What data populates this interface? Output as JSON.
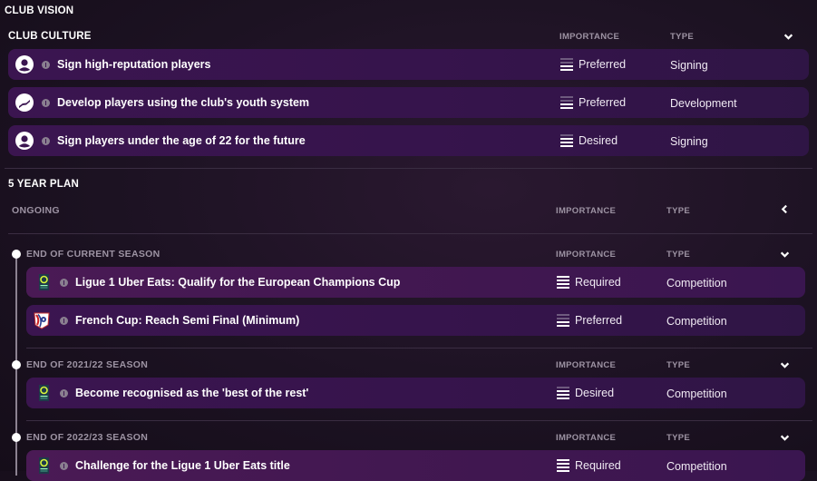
{
  "title": "CLUB VISION",
  "columns": {
    "importance": "IMPORTANCE",
    "type": "TYPE"
  },
  "club_culture": {
    "title": "CLUB CULTURE",
    "items": [
      {
        "icon": "person-icon",
        "label": "Sign high-reputation players",
        "importance": "Preferred",
        "importance_level": 2,
        "type": "Signing"
      },
      {
        "icon": "youth-development-icon",
        "label": "Develop players using the club's youth system",
        "importance": "Preferred",
        "importance_level": 2,
        "type": "Development"
      },
      {
        "icon": "person-icon",
        "label": "Sign players under the age of 22 for the future",
        "importance": "Desired",
        "importance_level": 3,
        "type": "Signing"
      }
    ]
  },
  "five_year_plan": {
    "title": "5 YEAR PLAN",
    "ongoing": {
      "title": "ONGOING"
    },
    "groups": [
      {
        "title": "END OF CURRENT SEASON",
        "items": [
          {
            "icon": "ligue1-logo-icon",
            "label": "Ligue 1 Uber Eats: Qualify for the European Champions Cup",
            "importance": "Required",
            "importance_level": 4,
            "type": "Competition"
          },
          {
            "icon": "french-cup-logo-icon",
            "label": "French Cup: Reach Semi Final (Minimum)",
            "importance": "Preferred",
            "importance_level": 2,
            "type": "Competition"
          }
        ]
      },
      {
        "title": "END OF 2021/22 SEASON",
        "items": [
          {
            "icon": "ligue1-logo-icon",
            "label": "Become recognised as the 'best of the rest'",
            "importance": "Desired",
            "importance_level": 3,
            "type": "Competition"
          }
        ]
      },
      {
        "title": "END OF 2022/23 SEASON",
        "items": [
          {
            "icon": "ligue1-logo-icon",
            "label": "Challenge for the Ligue 1 Uber Eats title",
            "importance": "Required",
            "importance_level": 4,
            "type": "Competition"
          }
        ]
      }
    ]
  }
}
